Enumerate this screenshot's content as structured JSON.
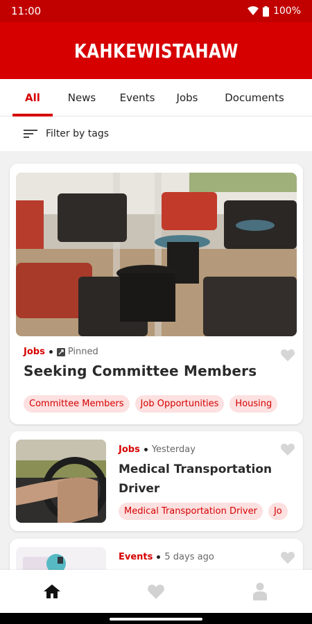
{
  "status_bar": {
    "time": "11:00",
    "battery": "100%"
  },
  "app": {
    "title": "KAHKEWISTAHAW"
  },
  "tabs": [
    {
      "label": "All",
      "active": true
    },
    {
      "label": "News",
      "active": false
    },
    {
      "label": "Events",
      "active": false
    },
    {
      "label": "Jobs",
      "active": false
    },
    {
      "label": "Documents",
      "active": false
    }
  ],
  "filter": {
    "label": "Filter by tags"
  },
  "posts": [
    {
      "category": "Jobs",
      "meta": "Pinned",
      "title": "Seeking Committee Members",
      "tags": [
        "Committee Members",
        "Job Opportunities",
        "Housing"
      ],
      "image": "lounge-chairs-photo"
    },
    {
      "category": "Jobs",
      "meta": "Yesterday",
      "title": "Medical Transportation Driver",
      "tags": [
        "Medical Transportation Driver",
        "Jo"
      ],
      "image": "steering-wheel-photo"
    },
    {
      "category": "Events",
      "meta": "5 days ago",
      "title": "",
      "image": "event-photo"
    }
  ],
  "icons": {
    "filter": "filter-lines-icon",
    "pin": "pin-icon",
    "favorite": "heart-icon",
    "nav_home": "home-icon",
    "nav_favorites": "heart-icon",
    "nav_profile": "person-icon"
  },
  "colors": {
    "brand": "#d60000",
    "status_bar": "#c10000",
    "tag_bg": "#fde0e0"
  }
}
